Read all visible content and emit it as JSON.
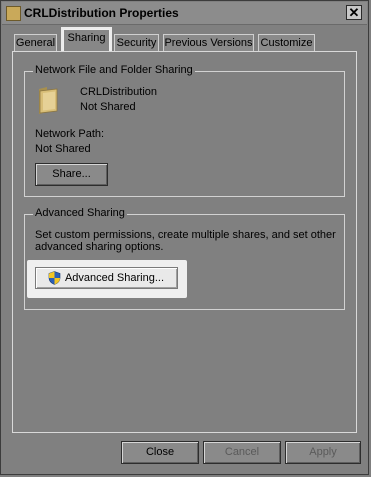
{
  "window": {
    "title": "CRLDistribution Properties",
    "close_glyph": "✕"
  },
  "tabs": [
    {
      "label": "General"
    },
    {
      "label": "Sharing"
    },
    {
      "label": "Security"
    },
    {
      "label": "Previous Versions"
    },
    {
      "label": "Customize"
    }
  ],
  "network_sharing": {
    "group_label": "Network File and Folder Sharing",
    "folder_name": "CRLDistribution",
    "folder_status": "Not Shared",
    "network_path_label": "Network Path:",
    "network_path_value": "Not Shared",
    "share_button": "Share..."
  },
  "advanced_sharing": {
    "group_label": "Advanced Sharing",
    "description_line1": "Set custom permissions, create multiple shares, and set other",
    "description_line2": "advanced sharing options.",
    "button": "Advanced Sharing..."
  },
  "footer": {
    "close": "Close",
    "cancel": "Cancel",
    "apply": "Apply"
  },
  "colors": {
    "highlight": "#efefef",
    "folder": "#d8be78"
  },
  "icons": {
    "folder": "folder-icon",
    "shield": "uac-shield-icon"
  }
}
